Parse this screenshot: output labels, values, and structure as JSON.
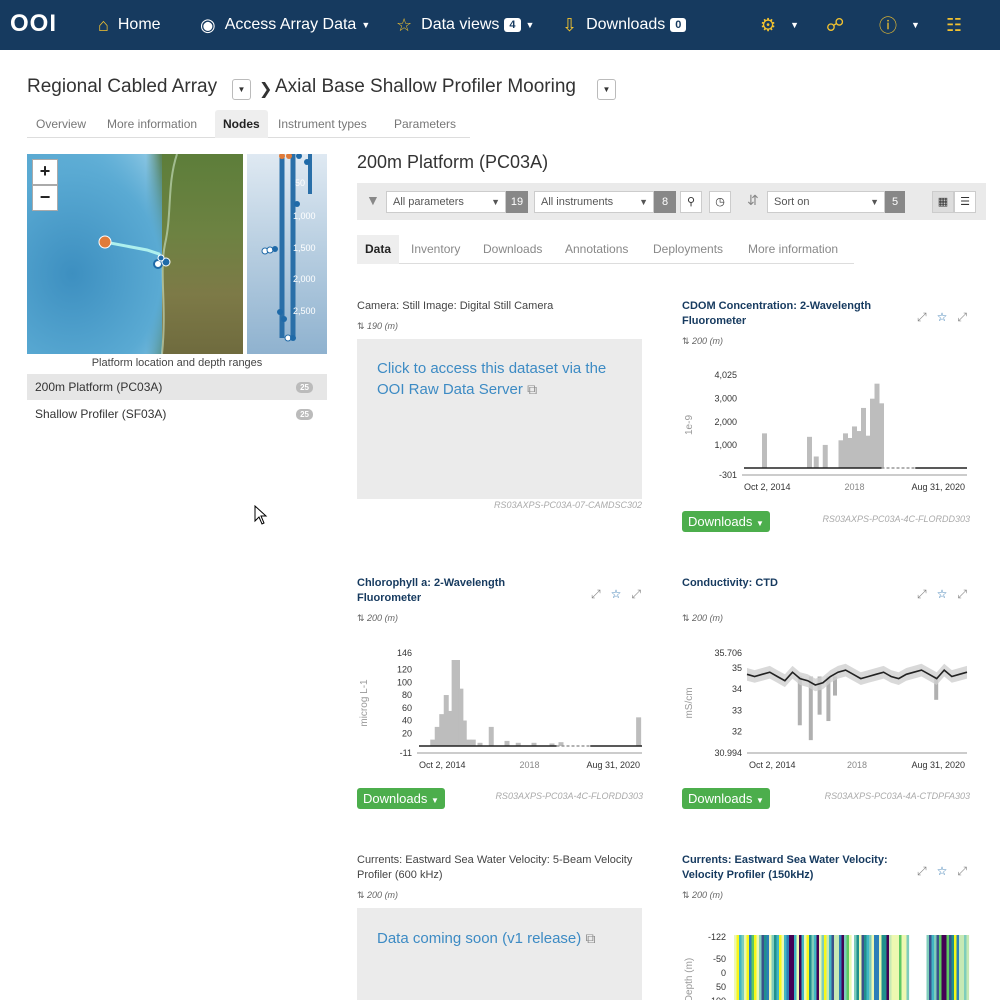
{
  "nav": {
    "logo": "OOI",
    "home": "Home",
    "access": "Access Array Data",
    "views": "Data views",
    "views_count": "4",
    "downloads": "Downloads",
    "downloads_count": "0"
  },
  "breadcrumb": {
    "array": "Regional Cabled Array",
    "site": "Axial Base Shallow Profiler Mooring"
  },
  "site_tabs": [
    "Overview",
    "More information",
    "Nodes",
    "Instrument types",
    "Parameters"
  ],
  "map": {
    "caption": "Platform location and depth ranges",
    "depth_labels": [
      "50",
      "1,000",
      "1,500",
      "2,000",
      "2,500"
    ],
    "zoom_in": "+",
    "zoom_out": "−"
  },
  "platforms": [
    {
      "name": "200m Platform (PC03A)",
      "count": "25"
    },
    {
      "name": "Shallow Profiler (SF03A)",
      "count": "25"
    }
  ],
  "main": {
    "title": "200m Platform (PC03A)",
    "params_select": "All parameters",
    "params_count": "19",
    "instr_select": "All instruments",
    "instr_count": "8",
    "sort_select": "Sort on",
    "sort_count": "5"
  },
  "data_tabs": [
    "Data",
    "Inventory",
    "Downloads",
    "Annotations",
    "Deployments",
    "More information"
  ],
  "downloads_label": "Downloads",
  "cards": [
    {
      "title": "Camera: Still Image: Digital Still Camera",
      "depth": "190 (m)",
      "link": "Click to access this dataset via the OOI Raw Data Server",
      "ref": "RS03AXPS-PC03A-07-CAMDSC302"
    },
    {
      "title": "CDOM Concentration: 2-Wavelength Fluorometer",
      "depth": "200 (m)",
      "ref": "RS03AXPS-PC03A-4C-FLORDD303"
    },
    {
      "title": "Chlorophyll a: 2-Wavelength Fluorometer",
      "depth": "200 (m)",
      "ref": "RS03AXPS-PC03A-4C-FLORDD303"
    },
    {
      "title": "Conductivity: CTD",
      "depth": "200 (m)",
      "ref": "RS03AXPS-PC03A-4A-CTDPFA303"
    },
    {
      "title": "Currents: Eastward Sea Water Velocity: 5-Beam Velocity Profiler (600 kHz)",
      "depth": "200 (m)",
      "link": "Data coming soon (v1 release)"
    },
    {
      "title": "Currents: Eastward Sea Water Velocity: Velocity Profiler (150kHz)",
      "depth": "200 (m)"
    }
  ],
  "chart_data": [
    {
      "type": "bar",
      "title": "CDOM Concentration: 2-Wavelength Fluorometer",
      "ylabel": "1e-9",
      "yticks": [
        "4,025",
        "3,000",
        "2,000",
        "1,000",
        "-301"
      ],
      "ylim": [
        -301,
        4025
      ],
      "xticks": [
        "Oct 2, 2014",
        "2018",
        "Aug 31, 2020"
      ],
      "values": [
        {
          "x": 0.1,
          "y": 1500
        },
        {
          "x": 0.3,
          "y": 1350
        },
        {
          "x": 0.33,
          "y": 500
        },
        {
          "x": 0.37,
          "y": 1000
        },
        {
          "x": 0.44,
          "y": 1200
        },
        {
          "x": 0.46,
          "y": 1500
        },
        {
          "x": 0.48,
          "y": 1300
        },
        {
          "x": 0.5,
          "y": 1800
        },
        {
          "x": 0.52,
          "y": 1600
        },
        {
          "x": 0.54,
          "y": 2600
        },
        {
          "x": 0.56,
          "y": 1400
        },
        {
          "x": 0.58,
          "y": 3000
        },
        {
          "x": 0.6,
          "y": 3650
        },
        {
          "x": 0.62,
          "y": 2800
        }
      ]
    },
    {
      "type": "bar",
      "title": "Chlorophyll a: 2-Wavelength Fluorometer",
      "ylabel": "microg L-1",
      "yticks": [
        "146",
        "120",
        "100",
        "80",
        "60",
        "40",
        "20",
        "-11"
      ],
      "ylim": [
        -11,
        146
      ],
      "xticks": [
        "Oct 2, 2014",
        "2018",
        "Aug 31, 2020"
      ],
      "values": [
        {
          "x": 0.07,
          "y": 10
        },
        {
          "x": 0.09,
          "y": 30
        },
        {
          "x": 0.11,
          "y": 50
        },
        {
          "x": 0.13,
          "y": 80
        },
        {
          "x": 0.15,
          "y": 55
        },
        {
          "x": 0.165,
          "y": 135
        },
        {
          "x": 0.18,
          "y": 135
        },
        {
          "x": 0.195,
          "y": 90
        },
        {
          "x": 0.21,
          "y": 40
        },
        {
          "x": 0.23,
          "y": 10
        },
        {
          "x": 0.25,
          "y": 10
        },
        {
          "x": 0.28,
          "y": 5
        },
        {
          "x": 0.33,
          "y": 30
        },
        {
          "x": 0.4,
          "y": 8
        },
        {
          "x": 0.45,
          "y": 5
        },
        {
          "x": 0.52,
          "y": 5
        },
        {
          "x": 0.6,
          "y": 4
        },
        {
          "x": 0.64,
          "y": 6
        },
        {
          "x": 0.985,
          "y": 45
        }
      ]
    },
    {
      "type": "line",
      "title": "Conductivity: CTD",
      "ylabel": "mS/cm",
      "yticks": [
        "35.706",
        "35",
        "34",
        "33",
        "32",
        "30.994"
      ],
      "ylim": [
        30.994,
        35.706
      ],
      "xticks": [
        "Oct 2, 2014",
        "2018",
        "Aug 31, 2020"
      ],
      "values": [
        34.7,
        34.6,
        34.7,
        34.8,
        34.6,
        34.4,
        34.8,
        34.5,
        34.4,
        34.2,
        34.3,
        34.6,
        34.8,
        34.9,
        34.7,
        34.5,
        34.6,
        34.7,
        34.8,
        34.6,
        34.5,
        34.7,
        34.8,
        34.9,
        34.7,
        34.5,
        34.9,
        34.6,
        34.7,
        34.8
      ],
      "spikes": [
        {
          "x": 0.24,
          "y": 32.3
        },
        {
          "x": 0.29,
          "y": 31.6
        },
        {
          "x": 0.33,
          "y": 32.8
        },
        {
          "x": 0.37,
          "y": 32.5
        },
        {
          "x": 0.4,
          "y": 33.7
        },
        {
          "x": 0.86,
          "y": 33.5
        }
      ]
    },
    {
      "type": "heatmap",
      "title": "Currents: Eastward Sea Water Velocity: Velocity Profiler (150kHz)",
      "ylabel": "Depth (m)",
      "yticks": [
        "-122",
        "-50",
        "0",
        "50",
        "100"
      ]
    }
  ]
}
